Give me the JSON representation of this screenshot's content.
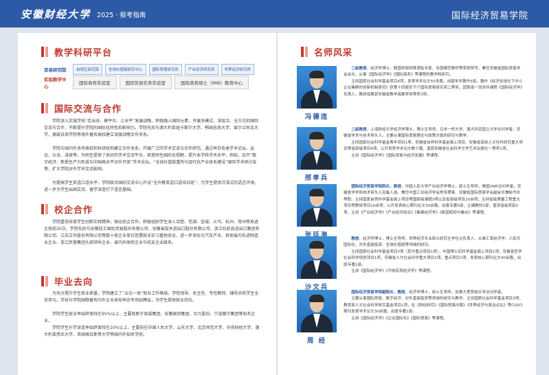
{
  "header": {
    "logo": "安徽财经大学",
    "separator": "|",
    "subtitle": "2025 · 报考指南",
    "college": "国际经济贸易学院"
  },
  "left": {
    "s1": {
      "title": "教学科研平台",
      "research_label": "贸易研究院",
      "research_tags": [
        "自贸区研究院",
        "全球价值链研究中心",
        "国际贸易研究所",
        "产业经济研究所",
        "世界经济研究所"
      ],
      "teaching_label": "实验教学中心",
      "teaching_tags": [
        "国际商务实验室",
        "国际贸易实务实验室",
        "国际商务硕士（MIB）教育中心"
      ]
    },
    "s2": {
      "title": "国际交流与合作",
      "p1": "学院深入实施学校“走出去、建平台、上水平”发展战略，积极融入国际元素，开展多模式、深层次、全方位的国际交流与合作，不断提升学院的国际化特色和影响力。学院先后与澳大利亚纽卡斯尔大学、韩国忠南大学、爱尔兰科克大学，挪威日商学院等境外著名高校建立深度战略合作关系。",
      "p2": "学院与国内外多所高校和科研机构建立合作关系，开展广泛的学术交流与合作研究。通过举办各类学术论坛、会议、沙龙、讲座等，为师生提供了良好的学术交流平台，拓宽师生国际化视野，提升本学科学术水平。例如，召开“数字经济、新质生产力形成与中国高水平对外开放”学术论坛，“全球价值链重构与现代化产业体系建设”国际学术研讨会等，扩大学院对外学术交流影响。",
      "p3": "为提高学生英语口语水平，学院联合国际交流中心开设“全外教英语口语培训班”，为学生提供沉浸式的语言环境，进一步为学生出国交流、留学深造打下语言基础。"
    },
    "s3": {
      "title": "校企合作",
      "p1": "学院重视培育学生创新实践精神，强化校企合作，积极组织学生深入合肥、芜湖、宣城、义乌、杭州、常州等地进企拓岗30次。学院先后与安徽轻工国际贸易股份有限公司、安徽省投木进出口股份有限公司、浙江纺织品进出口集团有限公司、江苏立华股份有限公司等数十家企业单位签署就业实习基地协议，进一步深化与汽车产业、其他省内先进制造业企业、浙江民营集团头部领导企业、省内外国贸企业与校友企业联系。"
    },
    "s4": {
      "title": "毕业去向",
      "p1": "为充分提升学生就业质量，学院建立了“五位一体”就业工作格局，学院领导、系主任、专任教师、辅导员和学生全员参与。学校与学院国際着有内外企业来校举办专场招聘会，为学生提供就业岗位。",
      "p2": "学院学生就业率始终保持在95%以上，主要就职于商城集团、安徽国贸集团、合力股份、宁波赛尔集团等知名企业。",
      "p3": "学院学生升学深造率始终保持在20%以上，主要前往中国人民大学、山东大学、北京师范大学、中央财经大学、澳大利亚悉尼大学、英国格拉斯哥大学等国内外知名学府。"
    }
  },
  "right": {
    "title": "名师风采",
    "teachers": [
      {
        "name": "冯德连",
        "role": "二级教授",
        "p1": "，经济学博士，联国务院特殊津贴专家、全国模范教师等荣誉称号，兼任安徽省国际贸易学会会长。从事《国际经济学》《国际商务》等课程的教学和研究。",
        "p2": "主持国家社会科学基金项目4项，发表学术论文50多篇，出版学术著作5部，著作《经济全球化下中小企业集群的创新机制研究》获第十四届安子介国际贸易研究奖二等奖。国家级一流本科课程《国际经济学》负责人，教研成果获安徽省教学成果奖特等奖3项。"
      },
      {
        "name": "邢孝兵",
        "role": "二级教授",
        "p1": "，上海财经大学经济学博士，博士生导师，日本一桥大学、澳大利亚国立大学访问学者，安徽省学术与技术带头人。主要从事国际贸易理论与政策方面的研究与教学。",
        "p2": "主持国家社会科学基金青年项目1项，安徽省自然科学基金面上项目、安徽省高校人文社科研究重大项目等省部级项目4项，公开发表学术论文数十篇，曾获安徽省社会科学文学艺术出版社一等奖1项。",
        "p3": "主讲《国际经济学》《国际贸易与经济发展》等课程。"
      },
      {
        "name": "张廷海",
        "role": "国际经济贸易学院院长，教授",
        "p1": "，中国人民大学产业经济学博士，硕士生导师，美国UNR访问学者，安徽省学术和技术带头人后备人选。兼任中国工业经济学会常务理事、安徽省国际贸易学会副会长兼秘书长等职。主持国家自然科学基金面上项目等国家级课题3项以及省部级项目20余项；主持省级质量工程重大项目等教研项目10余项，公开发表核心期刊论文30余篇，出版专著5部，主编教材2部，曾获省级奖励2项，主讲《产业经济学》《产业经济前沿》《集聚经济学》《新国和和与融合》等课程。"
      },
      {
        "name": "沙文兵",
        "role": "教授",
        "p1": "，经济学博士，博士生导师，世界经济专业硕士研究生学位点负责人，从事汇率经济学、人民币国际化、对外直接投资、全球价值链等领域的研究。",
        "p2": "主持国家社会科学基金项目3项（其中重点项目1项），中国博士后科学基金面上项目1项，安徽省哲学社会科学规划项目1项，安徽省人文社会科学重大项目1项。重点项目1项，发表核心期刊论文40余篇，出版专著1部。",
        "p3": "主讲《国际经济学》《开放宏观经济学》等课程。"
      },
      {
        "name": "周 经",
        "role": "国际经济贸易学院副院长，教授",
        "p1": "，经济学博士，硕士生导师，加拿大里贾纳大学访问学者。",
        "p2": "主要从事国际贸易、数字经济、对外直接投资等领域的研究与教学，主持国家社会科学基金项目3项，教育部人文社会科学研究基金项目1项，在《财经研究》《国际贸易问题》《世界经济与政治论坛》等CSSCI期刊发表学术论文30余篇，出版专著1部。",
        "p3": "主讲《国际经济学》《企业国际化》《国际贸易》等课程。"
      }
    ]
  }
}
